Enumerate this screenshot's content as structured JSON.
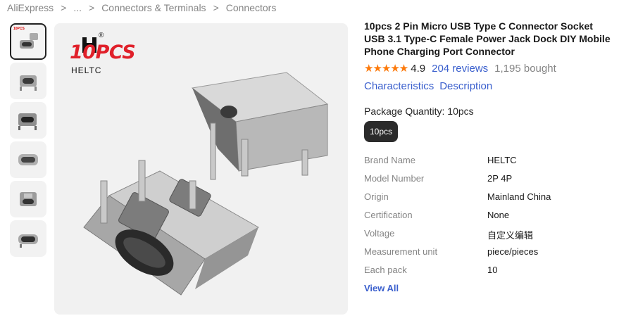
{
  "breadcrumb": {
    "items": [
      "AliExpress",
      "...",
      "Connectors & Terminals",
      "Connectors"
    ],
    "separator": ">"
  },
  "image": {
    "badge_text": "10PCS",
    "brand_text": "HELTC",
    "reg_mark": "®",
    "thumb_badge": "10PCS"
  },
  "product": {
    "title": "10pcs 2 Pin Micro USB Type C Connector Socket USB 3.1 Type-C Female Power Jack Dock DIY Mobile Phone Charging Port Connector",
    "stars": "★★★★★",
    "rating": "4.9",
    "reviews": "204 reviews",
    "bought": "1,195 bought",
    "tab_characteristics": "Characteristics",
    "tab_description": "Description",
    "package_label": "Package Quantity: 10pcs",
    "package_option": "10pcs",
    "view_all": "View All"
  },
  "specs": [
    {
      "key": "Brand Name",
      "value": "HELTC"
    },
    {
      "key": "Model Number",
      "value": "2P 4P"
    },
    {
      "key": "Origin",
      "value": "Mainland China"
    },
    {
      "key": "Certification",
      "value": "None"
    },
    {
      "key": "Voltage",
      "value": "自定义编辑"
    },
    {
      "key": "Measurement unit",
      "value": "piece/pieces"
    },
    {
      "key": "Each pack",
      "value": "10"
    }
  ],
  "colors": {
    "link": "#3a5fcd",
    "star": "#fd7a0b",
    "badge_red": "#e0202a",
    "muted": "#858585"
  }
}
